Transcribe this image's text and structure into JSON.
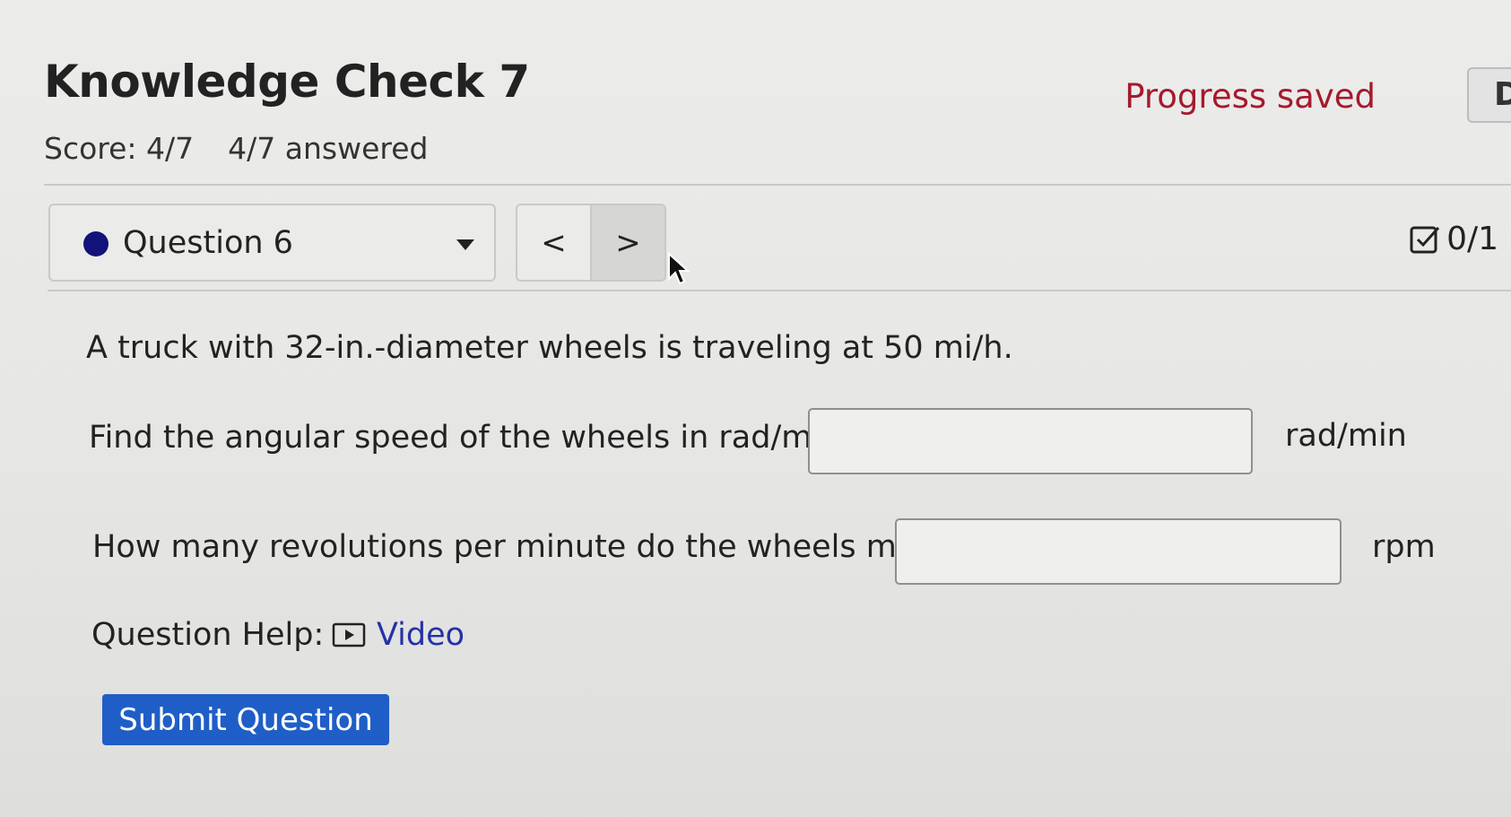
{
  "header": {
    "title": "Knowledge Check 7",
    "score": "Score: 4/7",
    "answered": "4/7 answered",
    "progress_status": "Progress saved",
    "cutoff_button": "D"
  },
  "question_nav": {
    "selected_question": "Question 6",
    "prev_symbol": "<",
    "next_symbol": ">",
    "points": "0/1"
  },
  "question": {
    "prompt": "A truck with 32-in.-diameter wheels is traveling at 50 mi/h.",
    "part1_label": "Find the angular speed of the wheels in rad/min:",
    "part1_value": "",
    "part1_unit": "rad/min",
    "part2_label": "How many revolutions per minute do the wheels make?",
    "part2_value": "",
    "part2_unit": "rpm"
  },
  "help": {
    "label": "Question Help:",
    "video_label": "Video"
  },
  "submit_label": "Submit Question",
  "colors": {
    "accent_blue": "#1f5ec6",
    "saved_red": "#a6192e",
    "link_blue": "#2432a8",
    "dot_navy": "#12127a"
  }
}
